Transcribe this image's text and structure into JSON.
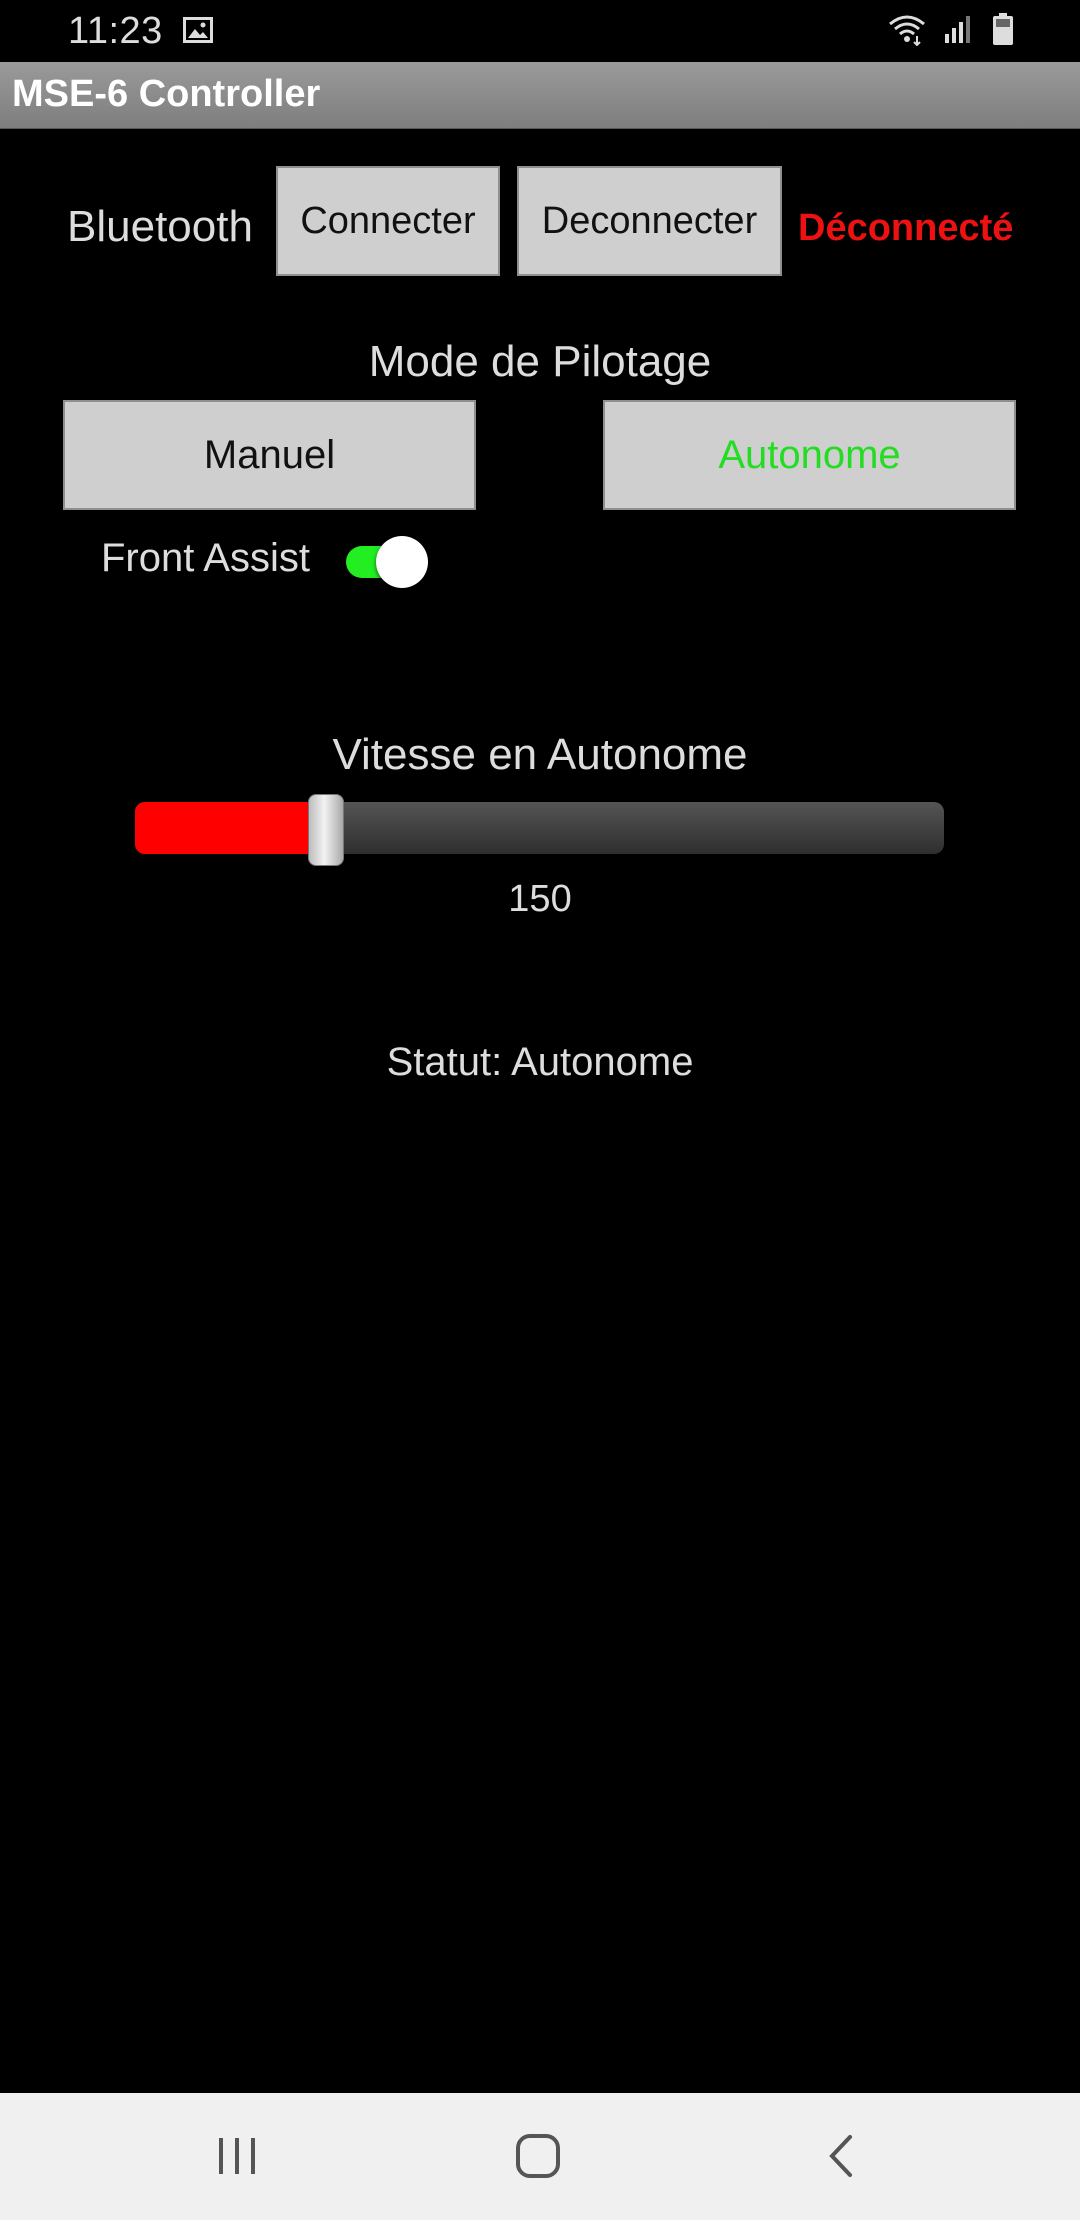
{
  "status_bar": {
    "time": "11:23",
    "icons": [
      "image-icon",
      "wifi-icon",
      "signal-icon",
      "battery-icon"
    ]
  },
  "app_bar": {
    "title": "MSE-6 Controller"
  },
  "bluetooth": {
    "label": "Bluetooth",
    "connect_label": "Connecter",
    "disconnect_label": "Deconnecter",
    "status": "Déconnecté",
    "status_color": "#ee1111"
  },
  "mode": {
    "title": "Mode de Pilotage",
    "manual_label": "Manuel",
    "auto_label": "Autonome",
    "selected": "Autonome",
    "selected_color": "#22dd22"
  },
  "front_assist": {
    "label": "Front Assist",
    "on": true,
    "on_color": "#22ee22"
  },
  "speed": {
    "title": "Vitesse en Autonome",
    "value_text": "150",
    "level_fraction": 0.235,
    "fill_color": "#ff0000"
  },
  "status_line": "Statut: Autonome",
  "nav_bar": {
    "buttons": [
      "recents-icon",
      "home-icon",
      "back-icon"
    ]
  }
}
